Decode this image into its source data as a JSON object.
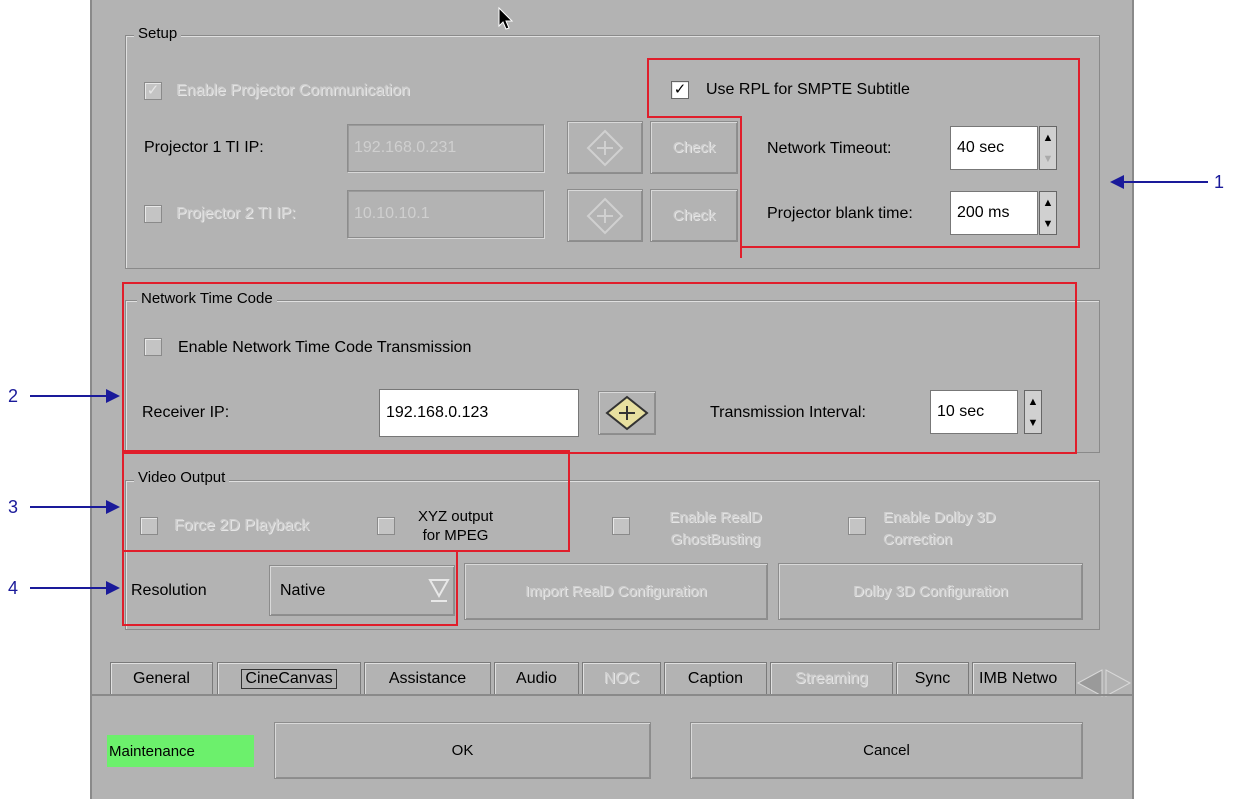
{
  "setup": {
    "legend": "Setup",
    "enable_projector_comm": "Enable Projector Communication",
    "projector1_label": "Projector 1 TI IP:",
    "projector1_ip": "192.168.0.231",
    "projector2_label": "Projector 2 TI IP:",
    "projector2_ip": "10.10.10.1",
    "check_label": "Check",
    "use_rpl": "Use RPL for SMPTE Subtitle",
    "network_timeout_label": "Network Timeout:",
    "network_timeout_value": "40 sec",
    "projector_blank_label": "Projector blank time:",
    "projector_blank_value": "200 ms"
  },
  "ntc": {
    "legend": "Network Time Code",
    "enable_label": "Enable Network Time Code Transmission",
    "receiver_label": "Receiver IP:",
    "receiver_ip": "192.168.0.123",
    "interval_label": "Transmission Interval:",
    "interval_value": "10 sec"
  },
  "video": {
    "legend": "Video Output",
    "force2d": "Force 2D Playback",
    "xyz_line1": "XYZ output",
    "xyz_line2": "for MPEG",
    "reald_line1": "Enable RealD",
    "reald_line2": "GhostBusting",
    "dolby_line1": "Enable Dolby 3D",
    "dolby_line2": "Correction",
    "resolution_label": "Resolution",
    "resolution_value": "Native",
    "import_reald": "Import RealD Configuration",
    "dolby_config": "Dolby 3D Configuration"
  },
  "tabs": [
    "General",
    "CineCanvas",
    "Assistance",
    "Audio",
    "NOC",
    "Caption",
    "Streaming",
    "Sync",
    "IMB Netwo"
  ],
  "footer": {
    "maintenance": "Maintenance",
    "ok": "OK",
    "cancel": "Cancel"
  },
  "callouts": [
    "1",
    "2",
    "3",
    "4"
  ],
  "colors": {
    "highlight": "#e01e2b",
    "callout_arrow": "#1a1a9a",
    "maintenance_bg": "#6cf06c",
    "window_bg": "#b3b3b3"
  }
}
